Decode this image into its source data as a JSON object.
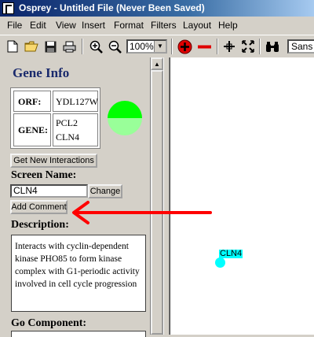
{
  "window": {
    "title": "Osprey - Untitled File (Never Been Saved)"
  },
  "menu": [
    "File",
    "Edit",
    "View",
    "Insert",
    "Format",
    "Filters",
    "Layout",
    "Help"
  ],
  "toolbar": {
    "zoom": "100%",
    "font": "Sans",
    "icons": [
      "new-file-icon",
      "open-folder-icon",
      "save-icon",
      "print-icon",
      "zoom-in-icon",
      "zoom-out-icon",
      "add-node-icon",
      "remove-node-icon",
      "crosshair-icon",
      "fit-view-icon",
      "find-icon"
    ]
  },
  "panel": {
    "title": "Gene Info",
    "orf_label": "ORF:",
    "orf_value": "YDL127W",
    "gene_label": "GENE:",
    "gene_value_1": "PCL2",
    "gene_value_2": "CLN4",
    "get_interactions": "Get New Interactions",
    "screen_name_label": "Screen Name:",
    "screen_name_value": "CLN4",
    "change_button": "Change",
    "add_comment_button": "Add Comment",
    "description_label": "Description:",
    "description_text": "Interacts with cyclin-dependent kinase PHO85 to form kinase complex with G1-periodic activity involved in cell cycle progression",
    "go_component_label": "Go Component:",
    "node_colors": {
      "top": "#00ff00",
      "bottom": "#99ff99"
    }
  },
  "canvas": {
    "node_label": "CLN4",
    "node_color": "#00ffff"
  },
  "annotation": {
    "arrow_color": "#ff0000"
  }
}
